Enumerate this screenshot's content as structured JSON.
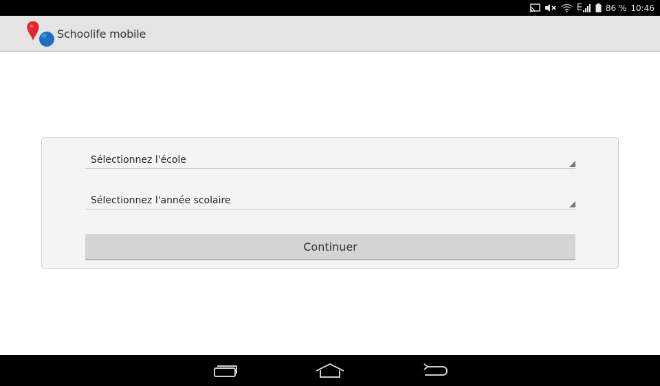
{
  "status_bar": {
    "battery_percent": "86 %",
    "time": "10:46",
    "network_type": "E",
    "icons": [
      "cast-icon",
      "mute-icon",
      "wifi-icon",
      "signal-icon",
      "battery-icon"
    ]
  },
  "app_bar": {
    "title": "Schoolife mobile",
    "logo_colors": [
      "#e8212e",
      "#1e6fc1"
    ]
  },
  "form": {
    "school_select": {
      "placeholder": "Sélectionnez l'école"
    },
    "year_select": {
      "placeholder": "Sélectionnez l'année scolaire"
    },
    "continue_label": "Continuer"
  },
  "nav_bar": {
    "buttons": [
      "recent-apps-icon",
      "home-icon",
      "back-icon"
    ]
  }
}
